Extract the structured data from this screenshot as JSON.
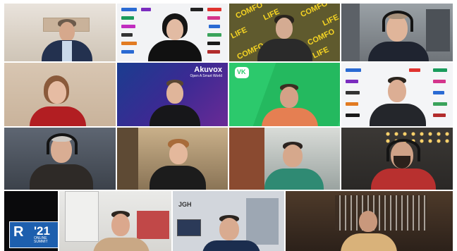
{
  "conference": {
    "tiles": [
      {
        "id": 0,
        "kind": "participant"
      },
      {
        "id": 1,
        "kind": "participant",
        "backdrop": "sponsor-wall"
      },
      {
        "id": 2,
        "kind": "participant",
        "backdrop_text": "COMFOLIFE"
      },
      {
        "id": 3,
        "kind": "participant",
        "headset": true
      },
      {
        "id": 4,
        "kind": "participant"
      },
      {
        "id": 5,
        "kind": "participant",
        "backdrop_brand": "Akuvox",
        "backdrop_tagline": "Open A Smart World"
      },
      {
        "id": 6,
        "kind": "participant",
        "backdrop_brand": "VK"
      },
      {
        "id": 7,
        "kind": "participant",
        "backdrop": "sponsor-wall"
      },
      {
        "id": 8,
        "kind": "participant",
        "headset": true
      },
      {
        "id": 9,
        "kind": "participant"
      },
      {
        "id": 10,
        "kind": "participant"
      },
      {
        "id": 11,
        "kind": "participant",
        "headset": true
      },
      {
        "id": 12,
        "kind": "event-logo",
        "logo_main": "R",
        "logo_year": "'21",
        "logo_sub": "ONLINE SUMMIT"
      },
      {
        "id": 13,
        "kind": "participant"
      },
      {
        "id": 14,
        "kind": "participant",
        "backdrop_brand": "JGH"
      },
      {
        "id": 15,
        "kind": "participant"
      }
    ]
  },
  "colors": {
    "logo_blue": "#1d5fae",
    "vk_green": "#2cc96c",
    "akuvox_purple": "#3b2a93",
    "comfolife_yellow": "#f5d423"
  }
}
